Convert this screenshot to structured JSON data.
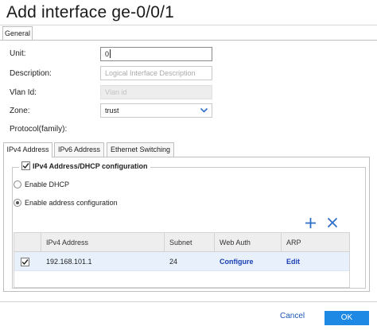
{
  "dialog": {
    "title": "Add interface ge-0/0/1"
  },
  "tabs": {
    "general": "General"
  },
  "form": {
    "unit_label": "Unit:",
    "unit_value": "0",
    "description_label": "Description:",
    "description_placeholder": "Logical Interface Description",
    "vlan_label": "Vlan Id:",
    "vlan_placeholder": "Vlan id",
    "zone_label": "Zone:",
    "zone_value": "trust",
    "protocol_label": "Protocol(family):"
  },
  "protocol_tabs": [
    "IPv4 Address",
    "IPv6 Address",
    "Ethernet Switching"
  ],
  "ipv4": {
    "section_label": "IPv4 Address/DHCP configuration",
    "enable_dhcp": "Enable DHCP",
    "enable_address_config": "Enable address configuration",
    "selected_mode": "Enable address configuration"
  },
  "table": {
    "headers": [
      "IPv4 Address",
      "Subnet",
      "Web Auth",
      "ARP"
    ],
    "rows": [
      {
        "ipv4": "192.168.101.1",
        "subnet": "24",
        "web_auth": "Configure",
        "arp": "Edit",
        "checked": true
      }
    ]
  },
  "footer": {
    "cancel": "Cancel",
    "ok": "OK"
  },
  "colors": {
    "primary": "#1e88e5",
    "link": "#1a3fb5",
    "selected_row": "#e7f0fb",
    "accent_icon": "#2f6fc9"
  },
  "icons": {
    "add": "plus-icon",
    "delete": "x-icon",
    "dropdown": "chevron-down-icon",
    "checkbox": "check-icon"
  }
}
